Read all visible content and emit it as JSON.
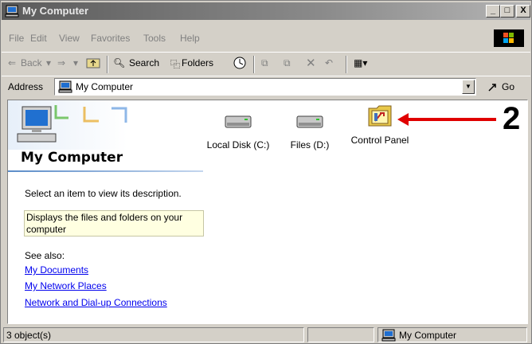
{
  "window": {
    "title": "My Computer"
  },
  "title_buttons": {
    "minimize": "_",
    "maximize": "□",
    "close": "X"
  },
  "menu": [
    "File",
    "Edit",
    "View",
    "Favorites",
    "Tools",
    "Help"
  ],
  "toolbar": {
    "back": "Back",
    "search": "Search",
    "folders": "Folders"
  },
  "address": {
    "label": "Address",
    "value": "My Computer",
    "go": "Go"
  },
  "banner": {
    "title": "My Computer"
  },
  "info": {
    "prompt": "Select an item to view its description.",
    "description": "Displays the files and folders on your computer",
    "see_also": "See also:",
    "links": [
      "My Documents",
      "My Network Places",
      "Network and Dial-up Connections"
    ]
  },
  "items": [
    {
      "label": "Local Disk (C:)",
      "icon": "hard-drive-icon"
    },
    {
      "label": "Files (D:)",
      "icon": "hard-drive-icon"
    },
    {
      "label": "Control Panel",
      "icon": "control-panel-icon"
    }
  ],
  "annotation": {
    "number": "2",
    "color": "#e00000"
  },
  "status": {
    "count": "3 object(s)",
    "location": "My Computer"
  }
}
